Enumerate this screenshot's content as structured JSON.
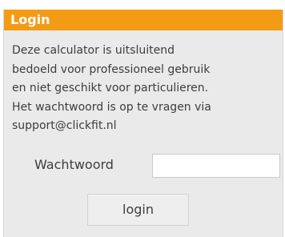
{
  "header": {
    "title": "Login"
  },
  "description": {
    "lines": [
      "Deze calculator is uitsluitend",
      "bedoeld voor professioneel gebruik",
      "en niet geschikt voor particulieren.",
      "Het wachtwoord is op te vragen via",
      "support@clickfit.nl"
    ]
  },
  "form": {
    "password_label": "Wachtwoord",
    "password_value": "",
    "login_label": "login"
  },
  "colors": {
    "accent": "#f49b16",
    "panel_background": "#eaeaea",
    "text": "#3d3d3d"
  }
}
